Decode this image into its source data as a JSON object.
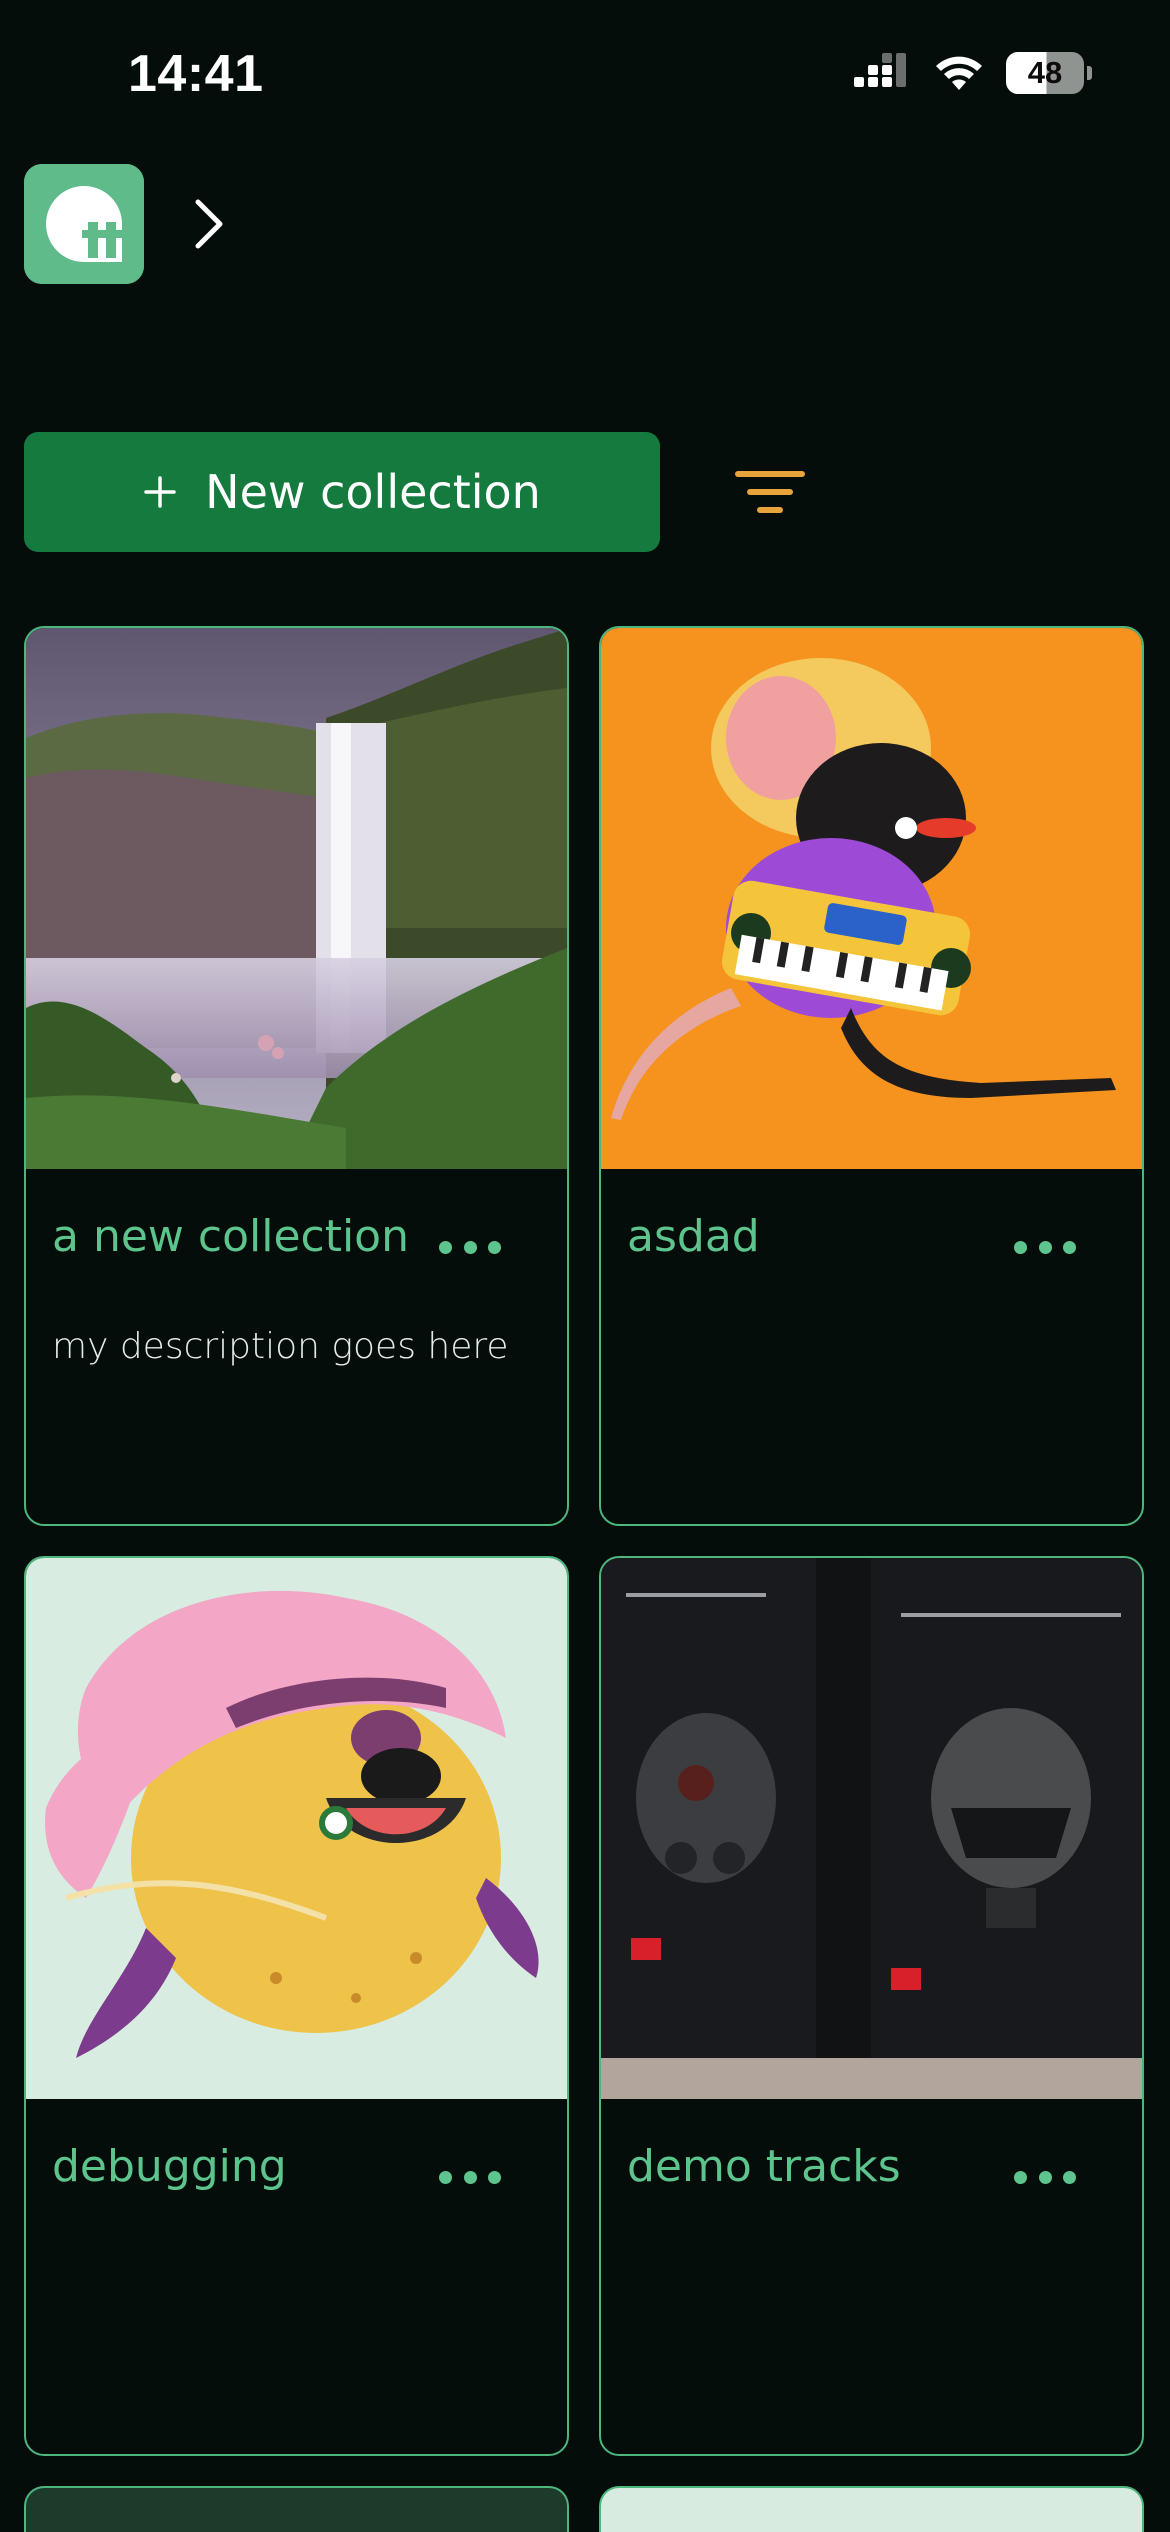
{
  "status_bar": {
    "time": "14:41",
    "battery_level": "48",
    "icons": [
      "cellular-signal-icon",
      "wifi-icon",
      "battery-icon"
    ]
  },
  "header": {
    "logo_icon": "app-logo-icon",
    "chevron_icon": "chevron-right-icon"
  },
  "toolbar": {
    "new_collection_label": "New collection",
    "plus_icon": "plus-icon",
    "filter_icon": "filter-icon"
  },
  "collections": [
    {
      "title": "a new collection",
      "description": "my description goes here",
      "thumbnail": "waterfall-landscape-photo"
    },
    {
      "title": "asdad",
      "description": "",
      "thumbnail": "rat-keyboard-illustration"
    },
    {
      "title": "debugging",
      "description": "",
      "thumbnail": "pirate-creature-illustration"
    },
    {
      "title": "demo tracks",
      "description": "",
      "thumbnail": "helmet-boxes-photo"
    }
  ],
  "colors": {
    "background": "#040d0a",
    "accent_green": "#5cc48c",
    "card_border": "#4db57e",
    "button_green": "#157a3e",
    "filter_orange": "#e8a33a",
    "logo_green": "#5fbb8a"
  }
}
